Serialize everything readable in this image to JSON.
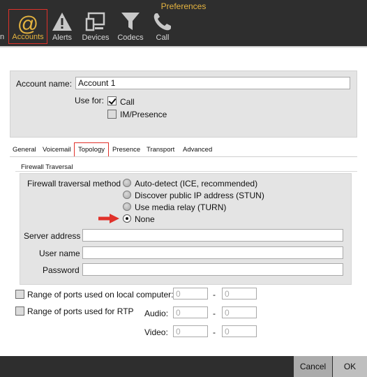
{
  "window": {
    "title": "Preferences"
  },
  "toolbar": {
    "cut_label": "n",
    "items": [
      {
        "label": "Accounts",
        "icon": "at-sign-icon",
        "selected": true
      },
      {
        "label": "Alerts",
        "icon": "warning-triangle-icon"
      },
      {
        "label": "Devices",
        "icon": "devices-icon"
      },
      {
        "label": "Codecs",
        "icon": "funnel-icon"
      },
      {
        "label": "Call",
        "icon": "phone-icon"
      }
    ]
  },
  "account": {
    "name_label": "Account name:",
    "name_value": "Account 1",
    "use_for_label": "Use for:",
    "call_label": "Call",
    "call_checked": true,
    "im_label": "IM/Presence",
    "im_checked": false
  },
  "tabs": [
    {
      "label": "General"
    },
    {
      "label": "Voicemail"
    },
    {
      "label": "Topology",
      "active": true
    },
    {
      "label": "Presence"
    },
    {
      "label": "Transport"
    },
    {
      "label": "Advanced"
    }
  ],
  "firewall": {
    "section_title": "Firewall Traversal",
    "method_label": "Firewall traversal method",
    "options": [
      "Auto-detect (ICE, recommended)",
      "Discover public IP address (STUN)",
      "Use media relay (TURN)",
      "None"
    ],
    "selected": "None",
    "server_label": "Server address",
    "server_value": "",
    "user_label": "User name",
    "user_value": "",
    "password_label": "Password",
    "password_value": ""
  },
  "ports": {
    "local_label": "Range of ports used on local computer:",
    "local_from": "0",
    "local_to": "0",
    "rtp_label": "Range of ports used for RTP",
    "audio_label": "Audio:",
    "audio_from": "0",
    "audio_to": "0",
    "video_label": "Video:",
    "video_from": "0",
    "video_to": "0",
    "dash": "-"
  },
  "buttons": {
    "cancel": "Cancel",
    "ok": "OK"
  },
  "colors": {
    "accent": "#e5b440",
    "highlight": "#e0312a",
    "toolbar_bg": "#2e2e2e",
    "panel_bg": "#e4e4e4"
  }
}
